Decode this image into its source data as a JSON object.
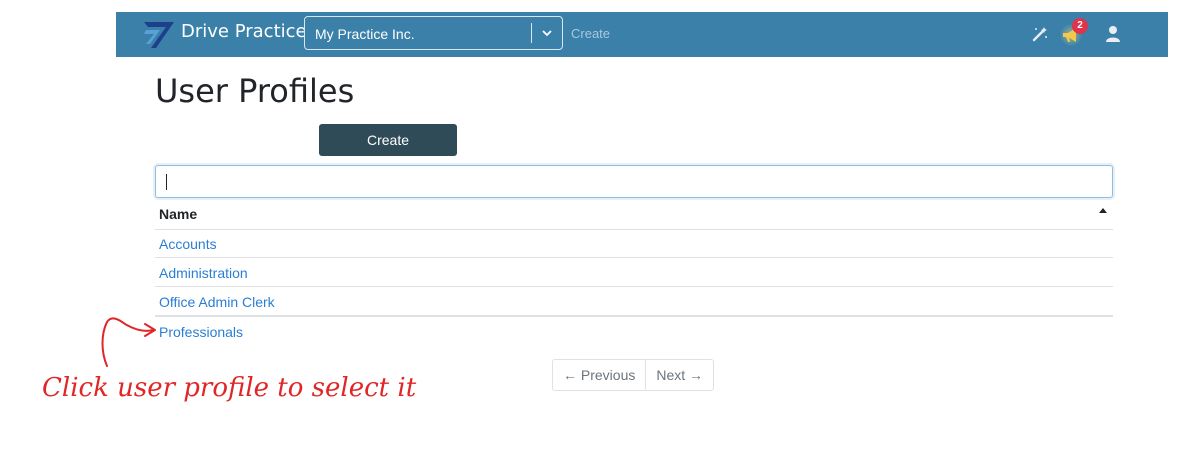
{
  "navbar": {
    "brand": "Drive Practice",
    "practice_select_value": "My Practice Inc.",
    "create_link": "Create",
    "notification_count": "2",
    "icons": {
      "logo": "drive-practice-logo-icon",
      "wand": "magic-wand-icon",
      "megaphone": "megaphone-icon",
      "user": "user-icon",
      "chevron": "chevron-down-icon"
    },
    "colors": {
      "bar": "#3a80a9",
      "badge": "#e0334c"
    }
  },
  "page": {
    "title": "User Profiles",
    "create_button": "Create",
    "search_value": ""
  },
  "table": {
    "columns": [
      "Name"
    ],
    "rows": [
      "Accounts",
      "Administration",
      "Office Admin Clerk",
      "Professionals"
    ]
  },
  "pagination": {
    "previous": "← Previous",
    "next": "Next →"
  },
  "annotation": {
    "text": "Click user profile to select it",
    "color": "#e02626"
  }
}
